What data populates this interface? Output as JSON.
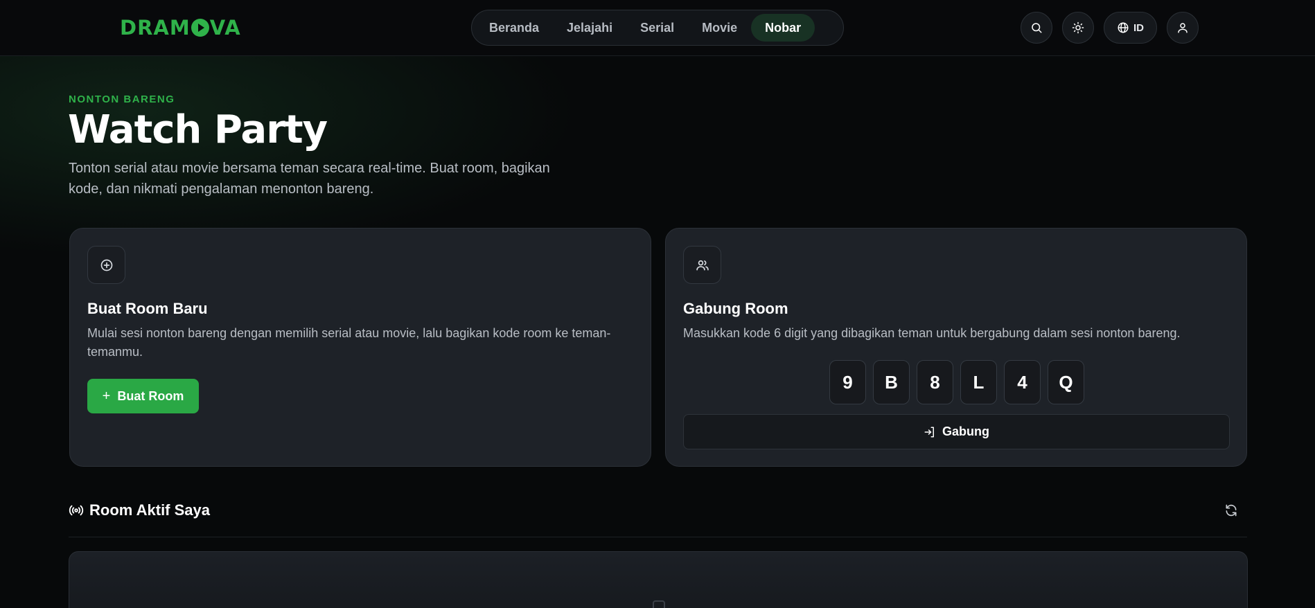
{
  "brand": {
    "logo_left": "DRAM",
    "logo_right": "VA"
  },
  "nav": {
    "items": [
      {
        "label": "Beranda"
      },
      {
        "label": "Jelajahi"
      },
      {
        "label": "Serial"
      },
      {
        "label": "Movie"
      },
      {
        "label": "Nobar"
      }
    ],
    "active": "Nobar"
  },
  "header": {
    "language_label": "ID"
  },
  "hero": {
    "eyebrow": "NONTON BARENG",
    "title": "Watch Party",
    "subtitle": "Tonton serial atau movie bersama teman secara real-time. Buat room, bagikan kode, dan nikmati pengalaman menonton bareng."
  },
  "create_room": {
    "title": "Buat Room Baru",
    "description": "Mulai sesi nonton bareng dengan memilih serial atau movie, lalu bagikan kode room ke teman-temanmu.",
    "button_label": "Buat Room"
  },
  "join_room": {
    "title": "Gabung Room",
    "description": "Masukkan kode 6 digit yang dibagikan teman untuk bergabung dalam sesi nonton bareng.",
    "code": [
      "9",
      "B",
      "8",
      "L",
      "4",
      "Q"
    ],
    "button_label": "Gabung"
  },
  "active_rooms": {
    "title": "Room Aktif Saya"
  },
  "colors": {
    "accent": "#2fb24a",
    "button_green": "#2aa845",
    "card_bg": "#1e2228",
    "page_bg": "#07090a"
  }
}
